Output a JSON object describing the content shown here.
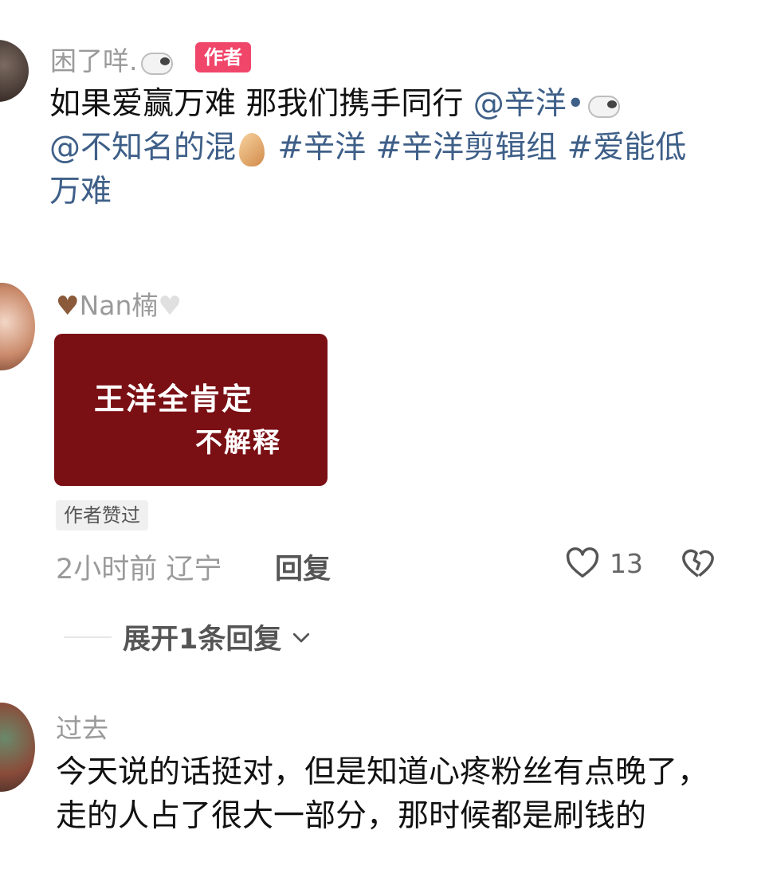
{
  "comments": [
    {
      "username": "困了咩.",
      "username_emoji": "sheep-icon",
      "author_badge": "作者",
      "text_plain": "如果爱赢万难 那我们携手同行 ",
      "mention1": "@辛洋•",
      "mention2": "@不知名的混",
      "tags": "#辛洋 #辛洋剪辑组 #爱能低万难"
    },
    {
      "username": "Nan楠",
      "image_text_line1": "王洋全肯定",
      "image_text_line2": "不解释",
      "liked_badge": "作者赞过",
      "time_location": "2小时前 辽宁",
      "reply_label": "回复",
      "like_count": "13",
      "expand_label": "展开1条回复"
    },
    {
      "username": "过去",
      "text": "今天说的话挺对，但是知道心疼粉丝有点晚了，走的人占了很大一部分，那时候都是刷钱的"
    }
  ],
  "colors": {
    "author_badge": "#f0466a",
    "mention": "#3e5f88",
    "image_bg": "#7a0f14"
  }
}
